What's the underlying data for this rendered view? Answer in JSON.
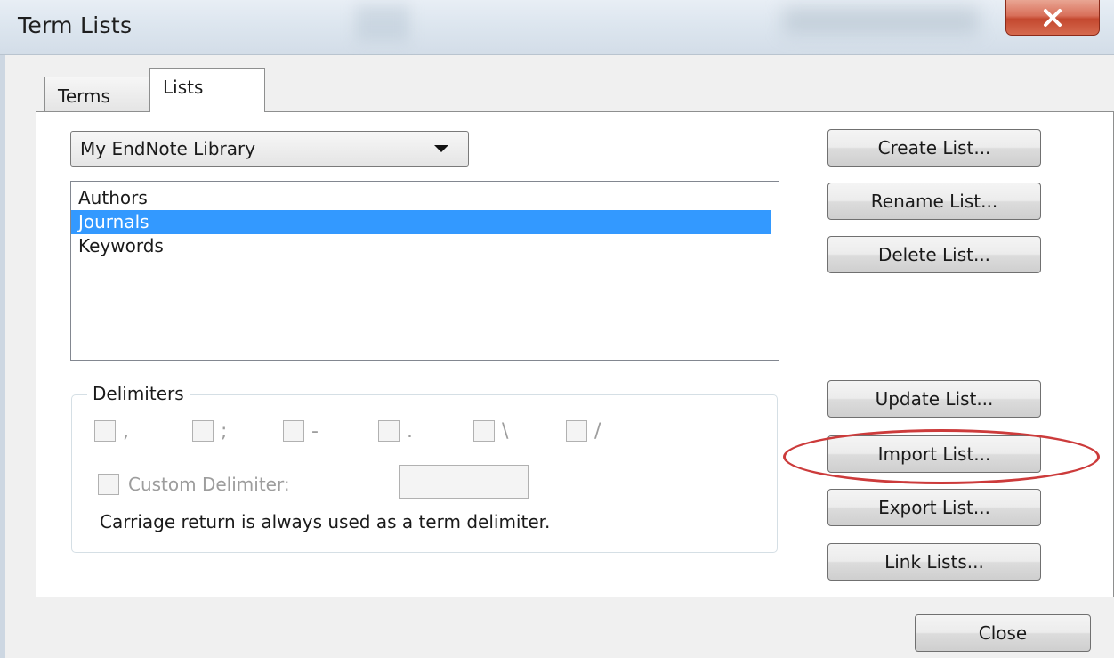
{
  "window": {
    "title": "Term Lists"
  },
  "tabs": [
    {
      "label": "Terms",
      "active": false
    },
    {
      "label": "Lists",
      "active": true
    }
  ],
  "library_select": {
    "value": "My EndNote Library"
  },
  "lists": {
    "items": [
      "Authors",
      "Journals",
      "Keywords"
    ],
    "selected": "Journals"
  },
  "delimiters": {
    "label": "Delimiters",
    "options": [
      ",",
      ";",
      "-",
      ".",
      "\\",
      "/"
    ],
    "custom_label": "Custom Delimiter:",
    "custom_value": "",
    "note": "Carriage return is always used as a term delimiter."
  },
  "buttons": {
    "create": "Create List...",
    "rename": "Rename List...",
    "delete": "Delete List...",
    "update": "Update List...",
    "import": "Import List...",
    "export": "Export List...",
    "link": "Link Lists...",
    "close": "Close"
  },
  "colors": {
    "selection": "#3399ff",
    "highlight_ring": "#cc3b3b",
    "close_button": "#c4482f"
  }
}
